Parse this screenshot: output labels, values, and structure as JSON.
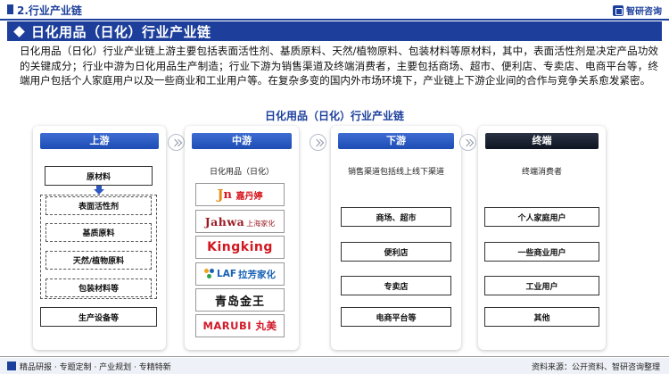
{
  "header": {
    "section_title": "2.行业产业链",
    "brand_name": "智研咨询"
  },
  "banner": {
    "title": "日化用品（日化）行业产业链"
  },
  "intro_text": "日化用品（日化）行业产业链上游主要包括表面活性剂、基质原料、天然/植物原料、包装材料等原材料，其中，表面活性剂是决定产品功效的关键成分；行业中游为日化用品生产制造；行业下游为销售渠道及终端消费者，主要包括商场、超市、便利店、专卖店、电商平台等，终端用户包括个人家庭用户以及一些商业和工业用户等。在复杂多变的国内外市场环境下，产业链上下游企业间的合作与竞争关系愈发紧密。",
  "diagram": {
    "title": "日化用品（日化）行业产业链",
    "upstream": {
      "header": "上游",
      "raw_materials_label": "原材料",
      "raw_material_items": [
        "表面活性剂",
        "基质原料",
        "天然/植物原料",
        "包装材料等"
      ],
      "equipment_label": "生产设备等"
    },
    "midstream": {
      "header": "中游",
      "subtitle": "日化用品（日化）",
      "logos": {
        "jn_text": "嘉丹婷",
        "jahwa_text": "Jahwa",
        "jahwa_cn": "上海家化",
        "kingking_text": "Kingking",
        "laf_text": "拉芳家化",
        "laf_prefix": "LAF",
        "qingdao_text": "青岛金王",
        "marubi_text": "MARUBI",
        "marubi_cn": "丸美"
      }
    },
    "downstream": {
      "header": "下游",
      "subtitle": "销售渠道包括线上线下渠道",
      "items": [
        "商场、超市",
        "便利店",
        "专卖店",
        "电商平台等"
      ]
    },
    "terminal": {
      "header": "终端",
      "subtitle": "终端消费者",
      "items": [
        "个人家庭用户",
        "一些商业用户",
        "工业用户",
        "其他"
      ]
    }
  },
  "footer": {
    "left_text": "精品研报 · 专题定制 · 产业规划 · 专精特新",
    "source_text": "资料来源：公开资料、智研咨询整理"
  },
  "colors": {
    "brand_blue": "#1c3f9c",
    "header_blue": "#1d4db4",
    "terminal_dark": "#0e1421"
  }
}
